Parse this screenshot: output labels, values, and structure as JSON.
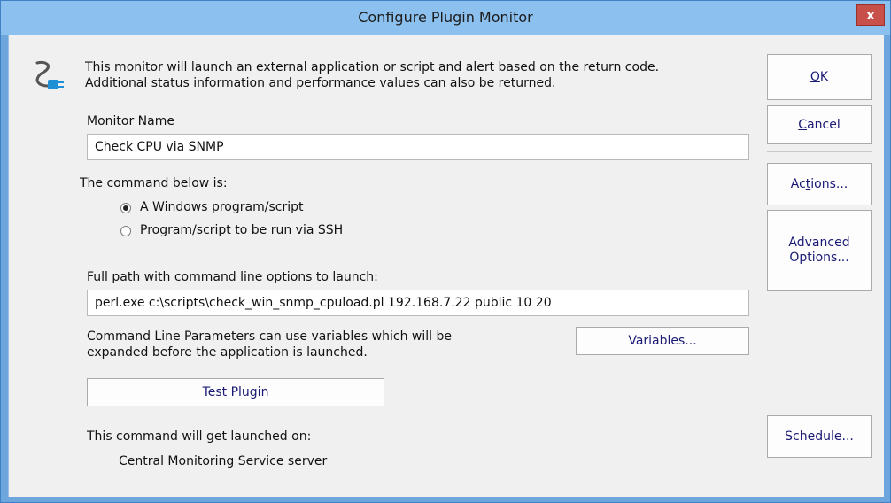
{
  "window": {
    "title": "Configure Plugin Monitor",
    "close_label": "x"
  },
  "header": {
    "icon": "plugin-connector-icon",
    "description_line1": "This monitor will launch an external application or script and alert based on the return code.",
    "description_line2": "Additional status information and performance values can also be returned."
  },
  "monitor_name": {
    "label": "Monitor Name",
    "value": "Check CPU via SNMP"
  },
  "command_type": {
    "label": "The command below is:",
    "options": [
      {
        "label": "A Windows program/script",
        "selected": true
      },
      {
        "label": "Program/script to be run via SSH",
        "selected": false
      }
    ]
  },
  "command": {
    "label": "Full path with command line options to launch:",
    "value": "perl.exe c:\\scripts\\check_win_snmp_cpuload.pl 192.168.7.22 public 10 20",
    "help_line1": "Command Line Parameters can use variables which will be",
    "help_line2": "expanded before the application is launched.",
    "variables_button": "Variables..."
  },
  "test_plugin_button": "Test Plugin",
  "launch": {
    "label": "This command will get launched on:",
    "target": "Central Monitoring Service server"
  },
  "side_buttons": {
    "ok": {
      "accel": "O",
      "rest": "K"
    },
    "cancel": {
      "accel": "C",
      "rest": "ancel"
    },
    "actions": {
      "pre": "Ac",
      "accel": "t",
      "rest": "ions..."
    },
    "advanced_line1": "Advanced",
    "advanced_line2": "Options...",
    "schedule": "Schedule..."
  },
  "colors": {
    "title_bar": "#8cc0ef",
    "close_button": "#c8504a",
    "button_text": "#1a1a75",
    "client_bg": "#f0f0f0"
  }
}
